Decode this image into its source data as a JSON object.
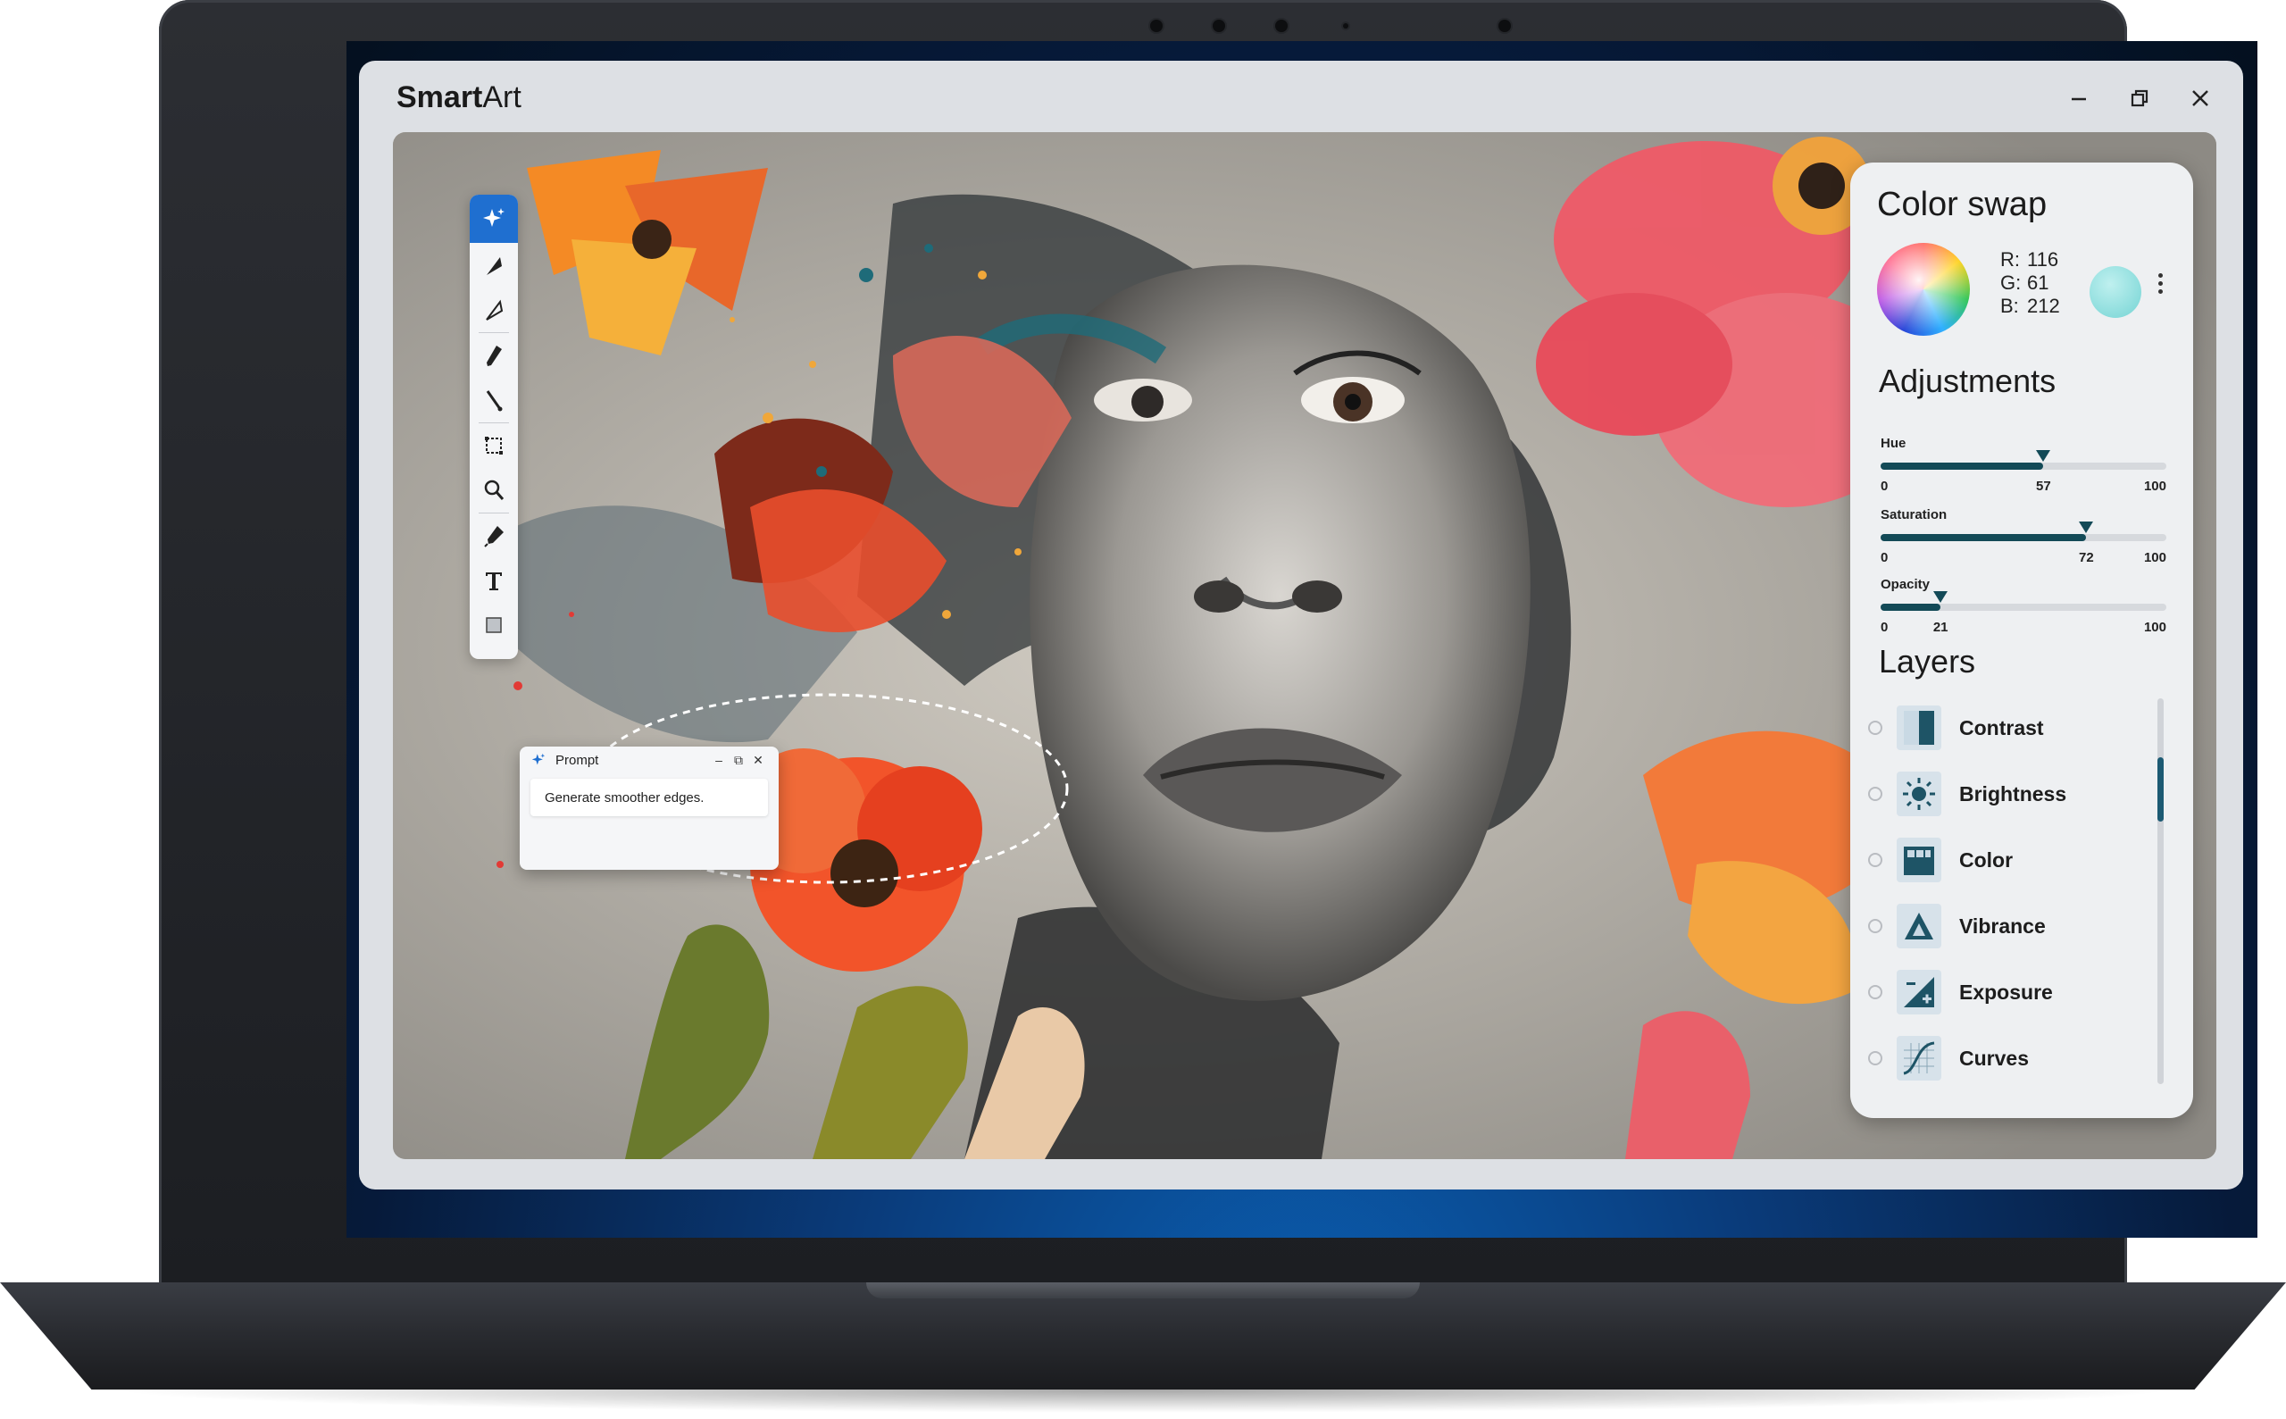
{
  "app": {
    "title_bold": "Smart",
    "title_rest": "Art"
  },
  "window_controls": {
    "minimize_icon": "minimize-icon",
    "restore_icon": "restore-icon",
    "close_icon": "close-icon"
  },
  "toolbar": {
    "tools": [
      "ai-sparkle-icon",
      "arrow-select-icon",
      "direct-select-icon",
      "pen-icon",
      "brush-icon",
      "crop-icon",
      "zoom-icon",
      "dropper-icon",
      "text-icon",
      "fill-icon"
    ]
  },
  "prompt": {
    "title": "Prompt",
    "text": "Generate smoother edges.",
    "minimize": "–",
    "restore": "⧉",
    "close": "✕"
  },
  "color_swap": {
    "title": "Color swap",
    "r_label": "R:",
    "r": "116",
    "g_label": "G:",
    "g": "61",
    "b_label": "B:",
    "b": "212",
    "swatch_color": "#8ddcdc"
  },
  "adjustments": {
    "title": "Adjustments",
    "sliders": [
      {
        "label": "Hue",
        "min": "0",
        "max": "100",
        "value": 57
      },
      {
        "label": "Saturation",
        "min": "0",
        "max": "100",
        "value": 72
      },
      {
        "label": "Opacity",
        "min": "0",
        "max": "100",
        "value": 21
      }
    ]
  },
  "layers": {
    "title": "Layers",
    "items": [
      {
        "name": "Contrast",
        "icon": "contrast-icon"
      },
      {
        "name": "Brightness",
        "icon": "brightness-icon"
      },
      {
        "name": "Color",
        "icon": "color-icon"
      },
      {
        "name": "Vibrance",
        "icon": "vibrance-icon"
      },
      {
        "name": "Exposure",
        "icon": "exposure-icon"
      },
      {
        "name": "Curves",
        "icon": "curves-icon"
      }
    ]
  },
  "colors": {
    "accent": "#1f6fd0",
    "slider": "#134a57",
    "panel": "#eef0f2"
  }
}
